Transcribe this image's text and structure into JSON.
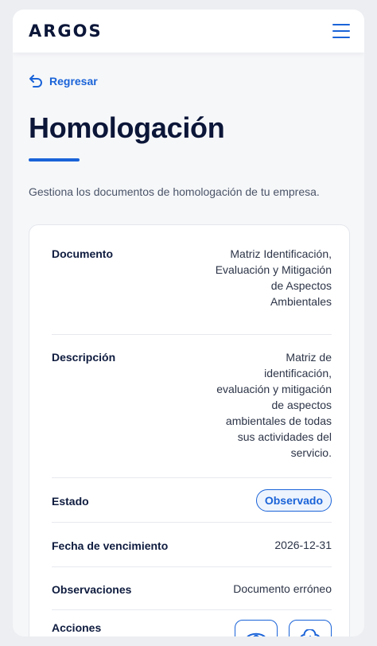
{
  "header": {
    "logo": "ARGOS"
  },
  "nav": {
    "back_label": "Regresar"
  },
  "page": {
    "title": "Homologación",
    "subtitle": "Gestiona los documentos de homologación de tu empresa."
  },
  "detail": {
    "documento": {
      "label": "Documento",
      "lines": [
        "Matriz Identificación,",
        "Evaluación y Mitigación",
        "de Aspectos",
        "Ambientales"
      ]
    },
    "descripcion": {
      "label": "Descripción",
      "lines": [
        "Matriz de",
        "identificación,",
        "evaluación y mitigación",
        "de aspectos",
        "ambientales de todas",
        "sus actividades del",
        "servicio."
      ]
    },
    "estado": {
      "label": "Estado",
      "value": "Observado"
    },
    "fecha": {
      "label": "Fecha de vencimiento",
      "value": "2026-12-31"
    },
    "observaciones": {
      "label": "Observaciones",
      "value": "Documento erróneo"
    },
    "acciones": {
      "label": "Acciones"
    }
  },
  "icons": {
    "menu": "hamburger-menu-icon",
    "back": "undo-arrow-icon",
    "view": "eye-icon",
    "download": "cloud-download-icon"
  },
  "colors": {
    "accent": "#1a63d8",
    "text_dark": "#0b1638",
    "badge_bg": "#eef4fd"
  }
}
